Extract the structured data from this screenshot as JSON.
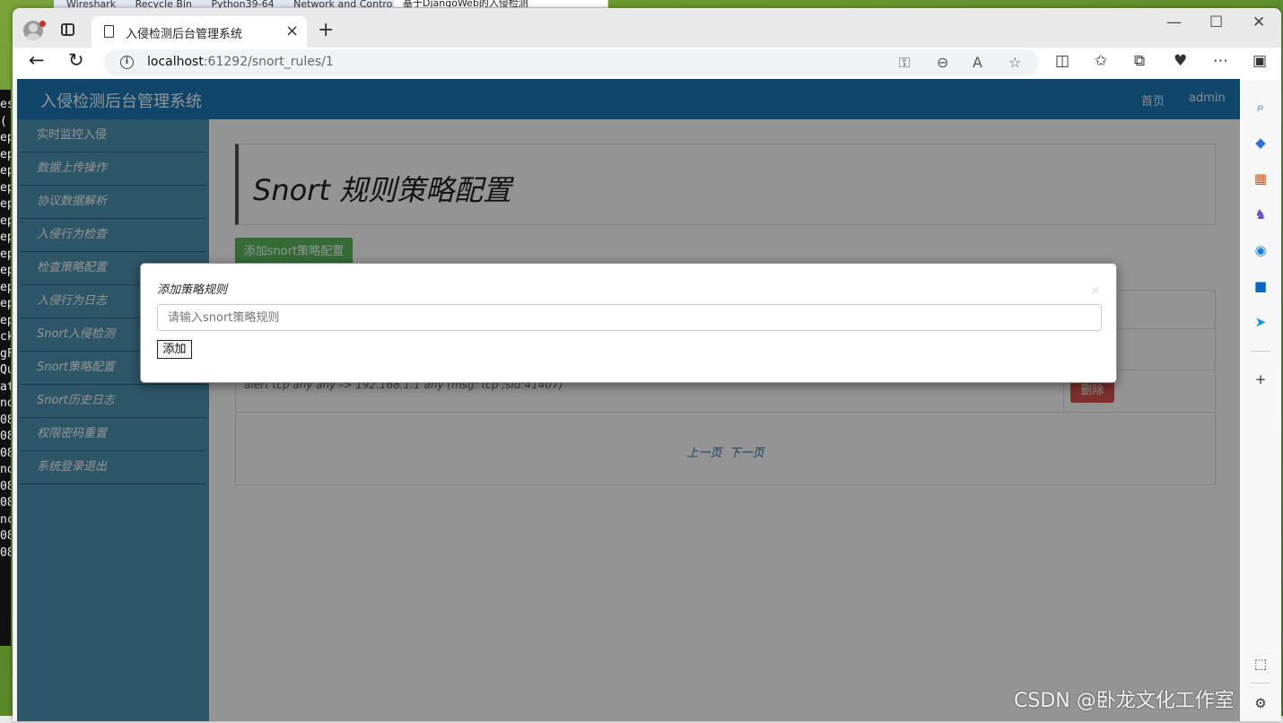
{
  "background": {
    "terminal_lines": [
      "es (",
      "ep",
      "ep",
      "ep",
      "ep",
      "ep",
      "ep",
      "ep",
      "ep",
      "ep",
      "ep",
      "ep",
      "ep",
      "ck",
      "gF",
      "Qu",
      "at",
      "no",
      "08",
      "08",
      "08",
      "no",
      "08",
      "08",
      "nc",
      "08",
      "08"
    ],
    "top_apps": [
      "Wireshark",
      "Recycle Bin",
      "Python39-64",
      "Network and Control Pa"
    ],
    "top_tab_text": "基于DjangoWeb的入侵检测"
  },
  "browser": {
    "tab_title": "入侵检测后台管理系统",
    "address": {
      "host": "localhost",
      "path": ":61292/snort_rules/1"
    },
    "controls": {
      "minimize": "—",
      "maximize": "☐",
      "close": "✕"
    }
  },
  "page": {
    "brand": "入侵检测后台管理系统",
    "nav_links": [
      "首页",
      "admin"
    ],
    "sidebar": [
      "实时监控入侵",
      "数据上传操作",
      "协议数据解析",
      "入侵行为检查",
      "检查策略配置",
      "入侵行为日志",
      "Snort入侵检测",
      "Snort策略配置",
      "Snort历史日志",
      "权限密码重置",
      "系统登录退出"
    ],
    "title": "Snort 规则策略配置",
    "add_button": "添加snort策略配置",
    "rule_row": "alert tcp any any -> 192.168.1.1 any (msg: tcp ;sid:41407)",
    "delete_button": "删除",
    "pager": {
      "prev": "上一页",
      "next": "下一页"
    }
  },
  "modal": {
    "label": "添加策略规则",
    "close": "×",
    "input_placeholder": "请输入snort策略规则",
    "submit": "添加"
  },
  "watermark": "CSDN @卧龙文化工作室"
}
